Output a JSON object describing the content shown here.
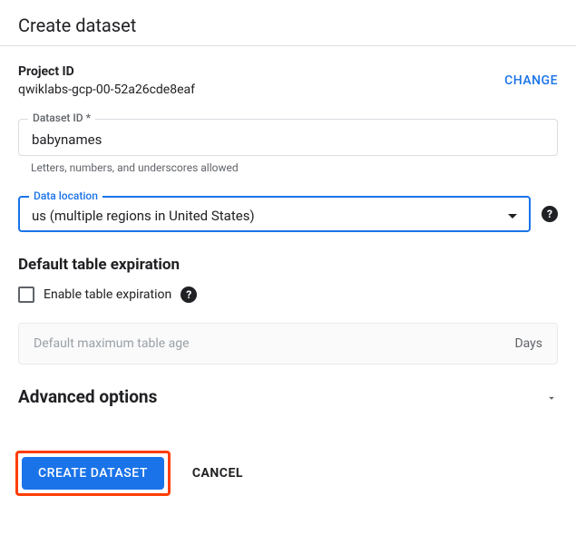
{
  "header": {
    "title": "Create dataset"
  },
  "project": {
    "label": "Project ID",
    "value": "qwiklabs-gcp-00-52a26cde8eaf",
    "change_label": "CHANGE"
  },
  "dataset_id": {
    "label": "Dataset ID *",
    "value": "babynames",
    "helper": "Letters, numbers, and underscores allowed"
  },
  "data_location": {
    "label": "Data location",
    "value": "us (multiple regions in United States)"
  },
  "expiration": {
    "section_label": "Default table expiration",
    "checkbox_label": "Enable table expiration",
    "placeholder": "Default maximum table age",
    "suffix": "Days"
  },
  "advanced": {
    "label": "Advanced options"
  },
  "actions": {
    "primary": "CREATE DATASET",
    "cancel": "CANCEL"
  }
}
